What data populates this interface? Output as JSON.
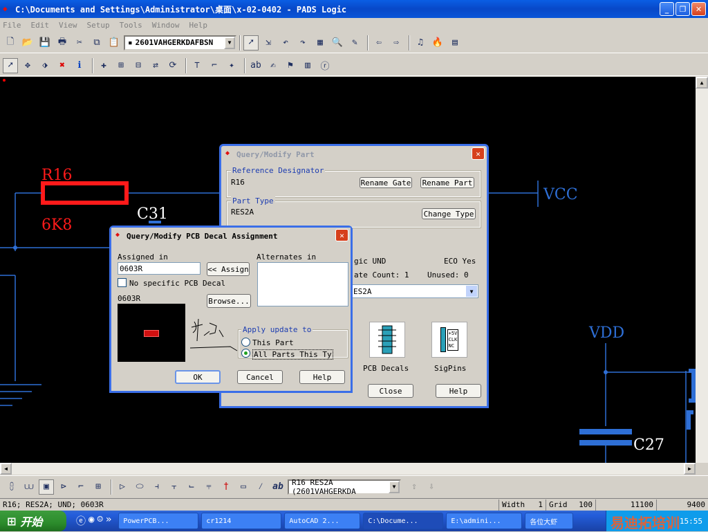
{
  "window": {
    "title": "C:\\Documents and Settings\\Administrator\\桌面\\x-02-0402 - PADS Logic",
    "min": "_",
    "max": "❐",
    "close": "✕"
  },
  "menu": [
    "File",
    "Edit",
    "View",
    "Setup",
    "Tools",
    "Window",
    "Help"
  ],
  "toolbar": {
    "part_combo": "2601VAHGERKDAFBSN"
  },
  "schematic": {
    "r16_ref": "R16",
    "r16_val": "6K8",
    "c31": "C31",
    "vcc": "VCC",
    "vdd": "VDD",
    "c27": "C27"
  },
  "part_dialog": {
    "title": "Query/Modify Part",
    "ref_group": "Reference Designator",
    "ref_value": "R16",
    "rename_gate": "Rename Gate",
    "rename_part": "Rename Part",
    "type_group": "Part Type",
    "type_value": "RES2A",
    "change_type": "Change Type",
    "logic_text": "gic  UND",
    "eco": "ECO Yes",
    "gate_count": "ate Count: 1",
    "unused": "Unused: 0",
    "decal_combo": "ES2A",
    "pcb_decals": "PCB Decals",
    "sigpins": "SigPins",
    "close": "Close",
    "help": "Help",
    "sig_icon": [
      "+5V",
      "CLK",
      "NC"
    ]
  },
  "decal_dialog": {
    "title": "Query/Modify PCB Decal Assignment",
    "assigned_label": "Assigned in",
    "assigned_value": "0603R",
    "assign_button": "<< Assign",
    "alternates_label": "Alternates in",
    "no_specific": "No specific PCB Decal",
    "preview_label": "0603R",
    "browse": "Browse...",
    "apply_group": "Apply update to",
    "this_part": "This Part",
    "all_parts": "All Parts This Ty",
    "ok": "OK",
    "cancel": "Cancel",
    "help": "Help"
  },
  "bottom_toolbar": {
    "combo": "R16 RES2A  (2601VAHGERKDA"
  },
  "status": {
    "left": "R16; RES2A; UND; 0603R",
    "width_label": "Width",
    "width_value": "1",
    "grid_label": "Grid",
    "grid_value": "100",
    "x": "11100",
    "y": "9400"
  },
  "taskbar": {
    "start": "开始",
    "tasks": [
      "PowerPCB...",
      "cr1214",
      "AutoCAD 2...",
      "C:\\Docume...",
      "E:\\admini...",
      "各位大虾"
    ],
    "clock": "15:55"
  },
  "watermark": "易迪拓培训"
}
